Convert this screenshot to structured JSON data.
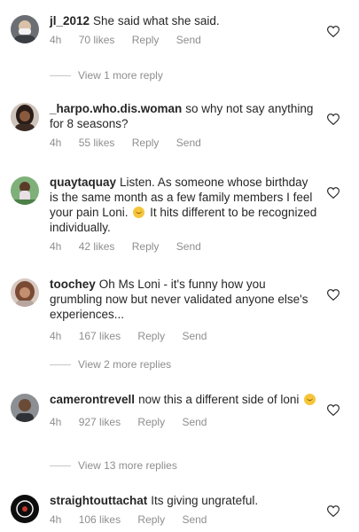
{
  "comments": [
    {
      "username": "jl_2012",
      "text": "She said what she said.",
      "time": "4h",
      "likes": "70 likes",
      "reply": "Reply",
      "send": "Send",
      "view_more": "View 1 more reply"
    },
    {
      "username": "_harpo.who.dis.woman",
      "text": "so why not say anything for 8 seasons?",
      "time": "4h",
      "likes": "55 likes",
      "reply": "Reply",
      "send": "Send"
    },
    {
      "username": "quaytaquay",
      "text": "Listen. As someone whose birthday is the same month as a few family members I feel your pain Loni.",
      "text_after_emoji": "It hits different to be recognized individually.",
      "emoji": "woozy-face-emoji",
      "time": "4h",
      "likes": "42 likes",
      "reply": "Reply",
      "send": "Send"
    },
    {
      "username": "toochey",
      "text": "Oh Ms Loni - it's funny how you grumbling now but never validated anyone else's experiences...",
      "time": "4h",
      "likes": "167 likes",
      "reply": "Reply",
      "send": "Send",
      "view_more": "View 2 more replies"
    },
    {
      "username": "camerontrevell",
      "text": "now this a different side of loni",
      "emoji": "woozy-face-emoji",
      "time": "4h",
      "likes": "927 likes",
      "reply": "Reply",
      "send": "Send",
      "view_more": "View 13 more replies"
    },
    {
      "username": "straightouttachat",
      "text": "Its giving ungrateful.",
      "time": "4h",
      "likes": "106 likes",
      "reply": "Reply",
      "send": "Send"
    }
  ],
  "icons": {
    "like": "heart-outline-icon"
  },
  "colors": {
    "text": "#262626",
    "muted": "#8e8e8e",
    "divider": "#c7c7c7"
  }
}
